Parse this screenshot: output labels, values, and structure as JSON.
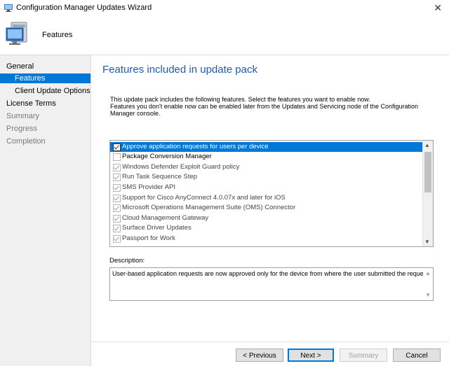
{
  "window": {
    "title": "Configuration Manager Updates Wizard",
    "close_glyph": "✕"
  },
  "header": {
    "page_label": "Features",
    "icon": "computer-icon"
  },
  "nav": {
    "items": [
      {
        "label": "General",
        "state": "normal"
      },
      {
        "label": "Features",
        "state": "selected"
      },
      {
        "label": "Client Update Options",
        "state": "normal"
      },
      {
        "label": "License Terms",
        "state": "normal"
      },
      {
        "label": "Summary",
        "state": "dim"
      },
      {
        "label": "Progress",
        "state": "dim"
      },
      {
        "label": "Completion",
        "state": "dim"
      }
    ]
  },
  "content": {
    "title": "Features included in update pack",
    "intro_line1": "This update pack includes the following features. Select the features you want to enable now.",
    "intro_line2": "Features you don't enable now can be enabled later from the Updates and Servicing node of the Configuration",
    "intro_line3": "Manager console."
  },
  "features": [
    {
      "label": "Approve application requests for users per device",
      "checked": true,
      "selected": true
    },
    {
      "label": "Package Conversion Manager",
      "checked": false,
      "selected": false
    },
    {
      "label": "Windows Defender Exploit Guard policy",
      "checked": true,
      "selected": false
    },
    {
      "label": "Run Task Sequence Step",
      "checked": true,
      "selected": false
    },
    {
      "label": "SMS Provider API",
      "checked": true,
      "selected": false
    },
    {
      "label": "Support for Cisco AnyConnect 4.0.07x and later for iOS",
      "checked": true,
      "selected": false
    },
    {
      "label": "Microsoft Operations Management Suite (OMS) Connector",
      "checked": true,
      "selected": false
    },
    {
      "label": "Cloud Management Gateway",
      "checked": true,
      "selected": false
    },
    {
      "label": "Surface Driver Updates",
      "checked": true,
      "selected": false
    },
    {
      "label": "Passport for Work",
      "checked": true,
      "selected": false
    }
  ],
  "description": {
    "label": "Description:",
    "text": "User-based application requests are now approved only for the device from where the user submitted the request"
  },
  "buttons": {
    "previous": "< Previous",
    "next": "Next >",
    "summary": "Summary",
    "cancel": "Cancel"
  },
  "colors": {
    "accent": "#0078d7",
    "title_blue": "#1e5bb0",
    "nav_bg": "#f0f0f0"
  }
}
